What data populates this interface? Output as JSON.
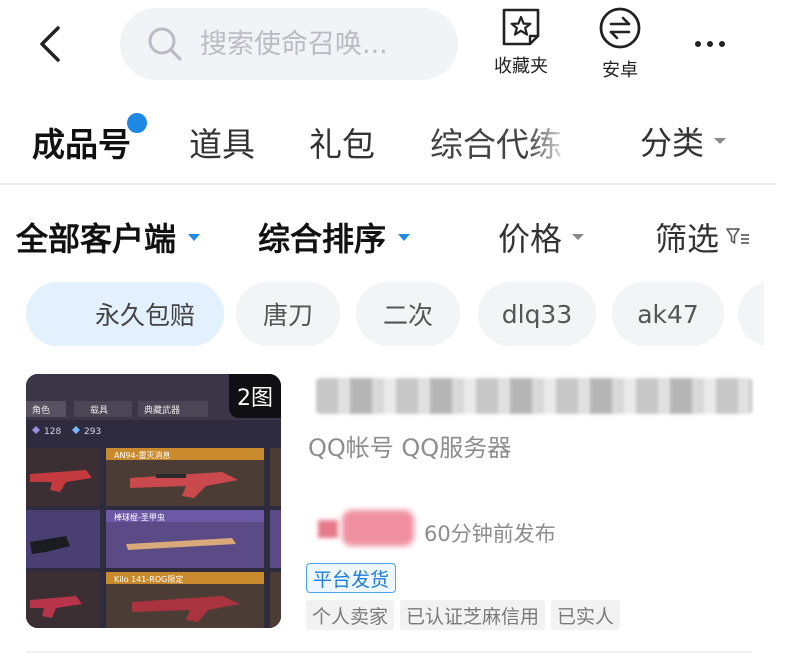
{
  "header": {
    "search_placeholder": "搜索使命召唤...",
    "favorites_label": "收藏夹",
    "platform_label": "安卓"
  },
  "main_tabs": [
    {
      "label": "成品号",
      "active": true
    },
    {
      "label": "道具"
    },
    {
      "label": "礼包"
    },
    {
      "label": "综合代练"
    }
  ],
  "category_label": "分类",
  "filters": {
    "client": "全部客户端",
    "sort": "综合排序",
    "price": "价格",
    "screen": "筛选"
  },
  "chips": [
    "永久包赔",
    "唐刀",
    "二次",
    "dlq33",
    "ak47"
  ],
  "listing": {
    "image_count": "2图",
    "subtitle": "QQ帐号 QQ服务器",
    "publish_time": "60分钟前发布",
    "platform_badge": "平台发货",
    "tags": [
      "个人卖家",
      "已认证芝麻信用",
      "已实人"
    ],
    "thumbnail": {
      "tabs": [
        "角色",
        "载具",
        "典藏武器"
      ],
      "stats": [
        "128",
        "293"
      ],
      "weapons": [
        "AN94-雷灭消息",
        "棒球棍-圣甲虫",
        "Kilo 141-ROG限定"
      ]
    }
  },
  "colors": {
    "accent": "#1f8ae6",
    "badge_blue": "#1f7ed8",
    "chip_selected": "#e3f0fd",
    "thumb_bg": "#2e2b3f"
  }
}
